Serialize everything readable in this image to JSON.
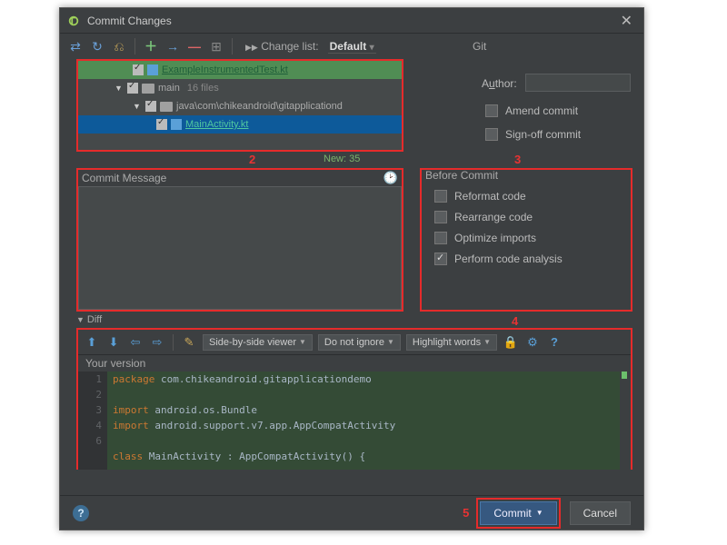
{
  "window": {
    "title": "Commit Changes"
  },
  "toolbar": {
    "changelist_label": "Change list:",
    "changelist_value": "Default",
    "git_label": "Git"
  },
  "tree": {
    "rows": [
      {
        "name": "ExampleInstrumentedTest.kt"
      },
      {
        "name": "main",
        "count": "16 files"
      },
      {
        "name": "java\\com\\chikeandroid\\gitapplicationd"
      },
      {
        "name": "MainActivity.kt"
      }
    ],
    "new_label": "New: 35"
  },
  "annotations": {
    "a2": "2",
    "a3": "3",
    "a4": "4",
    "a5": "5"
  },
  "right": {
    "author_label_pre": "A",
    "author_label_u": "u",
    "author_label_post": "thor:",
    "amend": "Amend commit",
    "signoff": "Sign-off commit"
  },
  "commit_msg": {
    "header": "Commit Message",
    "value": ""
  },
  "before": {
    "title": "Before Commit",
    "items": [
      {
        "label": "Reformat code",
        "checked": false
      },
      {
        "label": "Rearrange code",
        "checked": false
      },
      {
        "label": "Optimize imports",
        "checked": false
      },
      {
        "label": "Perform code analysis",
        "checked": true
      }
    ]
  },
  "diff": {
    "toggle": "Diff",
    "viewer": "Side-by-side viewer",
    "whitespace": "Do not ignore",
    "highlight": "Highlight words",
    "your_version": "Your version",
    "line_numbers": [
      "1",
      "2",
      "3",
      "4",
      "",
      "6"
    ],
    "code": {
      "l1_kw": "package",
      "l1_rest": " com.chikeandroid.gitapplicationdemo",
      "l3_kw": "import",
      "l3_rest": " android.os.Bundle",
      "l4_kw": "import",
      "l4_rest": " android.support.v7.app.AppCompatActivity",
      "l6_kw": "class",
      "l6_rest": " MainActivity : AppCompatActivity() {"
    }
  },
  "footer": {
    "commit": "Commit",
    "cancel": "Cancel"
  }
}
